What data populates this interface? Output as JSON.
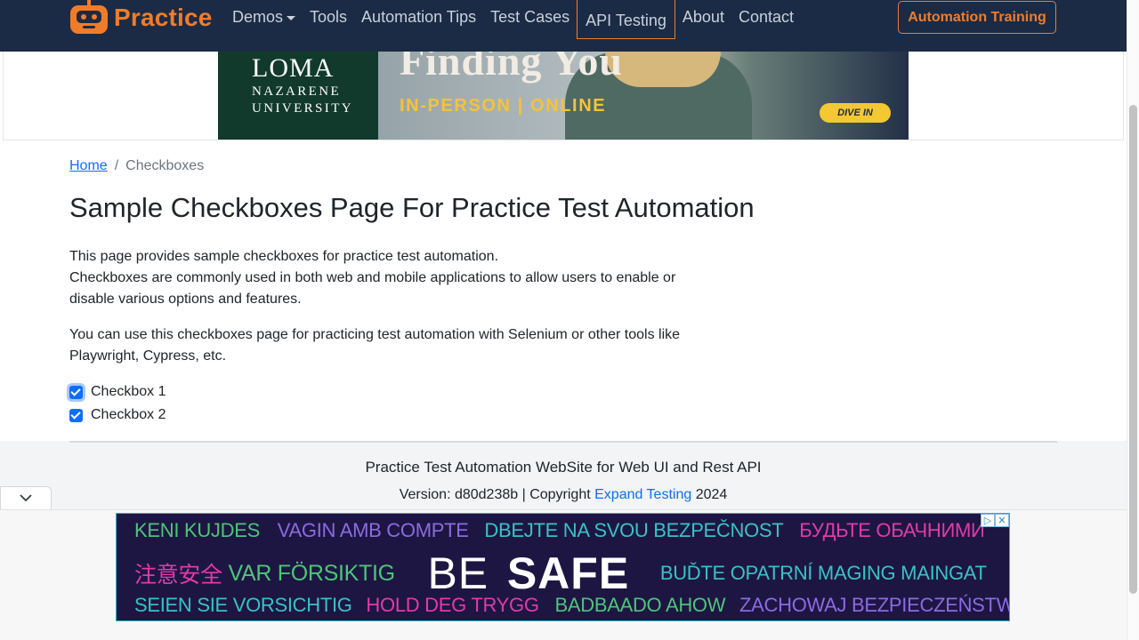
{
  "navbar": {
    "brand": "Practice",
    "items": [
      {
        "label": "Demos"
      },
      {
        "label": "Tools"
      },
      {
        "label": "Automation Tips"
      },
      {
        "label": "Test Cases"
      },
      {
        "label": "API Testing"
      },
      {
        "label": "About"
      },
      {
        "label": "Contact"
      }
    ],
    "cta_label": "Automation Training",
    "accent_color": "#f07c2a",
    "background_color": "#1b2b45"
  },
  "top_ad": {
    "university_line1": "LOMA",
    "university_line2": "NAZARENE",
    "university_line3": "UNIVERSITY",
    "headline": "Finding You",
    "modes": "IN-PERSON | ONLINE",
    "cta": "DIVE IN"
  },
  "breadcrumb": {
    "home": "Home",
    "separator": "/",
    "current": "Checkboxes"
  },
  "page": {
    "title": "Sample Checkboxes Page For Practice Test Automation",
    "paragraph1_line1": "This page provides sample checkboxes for practice test automation.",
    "paragraph1_line2": "Checkboxes are commonly used in both web and mobile applications to allow users to enable or disable various options and features.",
    "paragraph2": "You can use this checkboxes page for practicing test automation with Selenium or other tools like Playwright, Cypress, etc."
  },
  "checkboxes": [
    {
      "label": "Checkbox 1",
      "checked": true
    },
    {
      "label": "Checkbox 2",
      "checked": true
    }
  ],
  "footer": {
    "title": "Practice Test Automation WebSite for Web UI and Rest API",
    "version_prefix": "Version: d80d238b | Copyright ",
    "company": "Expand Testing",
    "year": " 2024"
  },
  "bottom_ad": {
    "line1": [
      "KENI KUJDES",
      "VAGIN AMB COMPTE",
      "DBEJTE NA SVOU BEZPEČNOST",
      "БУДЬТЕ ОБАЧНИМИ"
    ],
    "line2_left": [
      "注意安全",
      "VAR FÖRSIKTIG"
    ],
    "be": "BE",
    "safe": "SAFE",
    "line2_right": "BUĎTE OPATRNÍ MAGING MAINGAT",
    "line3": [
      "SEIEN SIE VORSICHTIG",
      "HOLD DEG TRYGG",
      "BADBAADO AHOW",
      "ZACHOWAJ BEZPIECZEŃSTWO"
    ]
  },
  "icons": {
    "logo": "robot-logo-icon",
    "collapse": "chevron-down-icon",
    "ad_choices": "adchoices-icon",
    "ad_close": "close-icon"
  }
}
